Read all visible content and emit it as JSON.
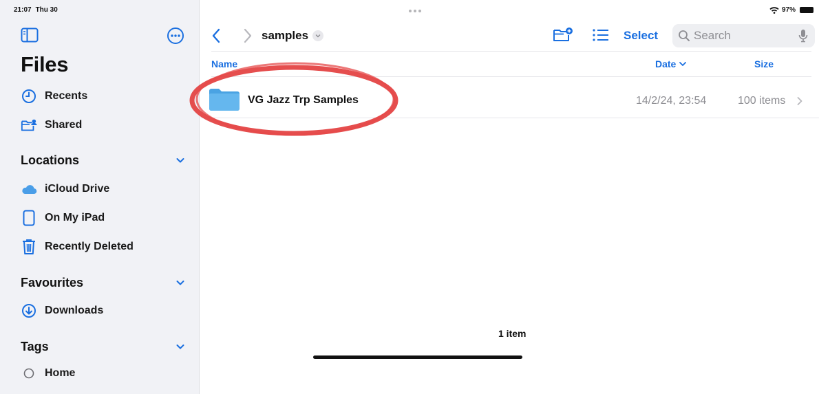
{
  "status": {
    "time": "21:07",
    "day": "Thu 30",
    "battery": "97%"
  },
  "sidebar": {
    "title": "Files",
    "top_items": [
      {
        "label": "Recents",
        "icon": "clock-icon"
      },
      {
        "label": "Shared",
        "icon": "shared-folder-icon"
      }
    ],
    "sections": [
      {
        "title": "Locations",
        "items": [
          {
            "label": "iCloud Drive",
            "icon": "icloud-icon"
          },
          {
            "label": "On My iPad",
            "icon": "ipad-icon"
          },
          {
            "label": "Recently Deleted",
            "icon": "trash-icon"
          }
        ]
      },
      {
        "title": "Favourites",
        "items": [
          {
            "label": "Downloads",
            "icon": "download-icon"
          }
        ]
      },
      {
        "title": "Tags",
        "items": [
          {
            "label": "Home",
            "icon": "tag-circle-icon"
          }
        ]
      }
    ]
  },
  "toolbar": {
    "folder_title": "samples",
    "select_label": "Select",
    "search_placeholder": "Search"
  },
  "columns": {
    "name": "Name",
    "date": "Date",
    "size": "Size"
  },
  "files": [
    {
      "name": "VG Jazz Trp Samples",
      "date": "14/2/24, 23:54",
      "size": "100 items"
    }
  ],
  "footer": {
    "count": "1 item"
  },
  "colors": {
    "accent": "#1a6fe0",
    "folder": "#5fb2ea",
    "annotation": "#e23b3b",
    "sidebar_bg": "#f1f2f6"
  }
}
